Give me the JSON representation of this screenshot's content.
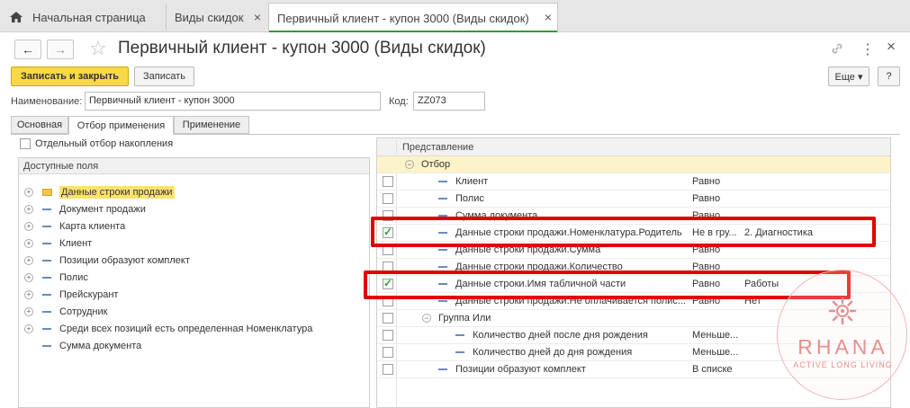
{
  "tabs": {
    "home_label": "Начальная страница",
    "tab2_label": "Виды скидок",
    "tab3_label": "Первичный клиент - купон 3000 (Виды скидок)",
    "close_glyph": "×"
  },
  "header": {
    "title": "Первичный клиент - купон 3000 (Виды скидок)",
    "back_glyph": "←",
    "forward_glyph": "→",
    "star_glyph": "☆",
    "link_glyph": "🔗",
    "menu_glyph": "⋮",
    "close_glyph": "×"
  },
  "toolbar": {
    "save_close_label": "Записать и закрыть",
    "save_label": "Записать",
    "more_label": "Еще ▾",
    "help_label": "?"
  },
  "fields": {
    "name_label": "Наименование:",
    "name_value": "Первичный клиент - купон 3000",
    "code_label": "Код:",
    "code_value": "ZZ073"
  },
  "form_tabs": [
    "Основная",
    "Отбор применения",
    "Применение"
  ],
  "separate_filter_label": "Отдельный отбор накопления",
  "left_panel": {
    "header": "Доступные поля",
    "items": [
      {
        "label": "Данные строки продажи",
        "kind": "folder",
        "selected": true
      },
      {
        "label": "Документ продажи",
        "kind": "field"
      },
      {
        "label": "Карта клиента",
        "kind": "field"
      },
      {
        "label": "Клиент",
        "kind": "field"
      },
      {
        "label": "Позиции образуют комплект",
        "kind": "field"
      },
      {
        "label": "Полис",
        "kind": "field"
      },
      {
        "label": "Прейскурант",
        "kind": "field"
      },
      {
        "label": "Сотрудник",
        "kind": "field"
      },
      {
        "label": "Среди всех позиций есть определенная Номенклатура",
        "kind": "field"
      },
      {
        "label": "Сумма документа",
        "kind": "field",
        "noexp": true
      }
    ]
  },
  "grid": {
    "header": "Представление",
    "rows": [
      {
        "type": "group",
        "name": "Отбор",
        "cond": "",
        "val": ""
      },
      {
        "checked": false,
        "name": "Клиент",
        "cond": "Равно",
        "val": ""
      },
      {
        "checked": false,
        "name": "Полис",
        "cond": "Равно",
        "val": ""
      },
      {
        "checked": false,
        "name": "Сумма документа",
        "cond": "Равно",
        "val": ""
      },
      {
        "checked": true,
        "name": "Данные строки продажи.Номенклатура.Родитель",
        "cond": "Не в гру...",
        "val": "2. Диагностика"
      },
      {
        "checked": false,
        "name": "Данные строки продажи.Сумма",
        "cond": "Равно",
        "val": ""
      },
      {
        "checked": false,
        "name": "Данные строки продажи.Количество",
        "cond": "Равно",
        "val": ""
      },
      {
        "checked": true,
        "name": "Данные строки.Имя табличной части",
        "cond": "Равно",
        "val": "Работы"
      },
      {
        "checked": false,
        "name": "Данные строки продажи.Не оплачивается полис...",
        "cond": "Равно",
        "val": "Нет"
      },
      {
        "checked": false,
        "type": "subgroup",
        "name": "Группа Или",
        "cond": "",
        "val": ""
      },
      {
        "checked": false,
        "name": "Количество дней после дня рождения",
        "cond": "Меньше...",
        "val": "",
        "indent": true
      },
      {
        "checked": false,
        "name": "Количество дней до дня рождения",
        "cond": "Меньше...",
        "val": "",
        "indent": true
      },
      {
        "checked": false,
        "name": "Позиции образуют комплект",
        "cond": "В списке",
        "val": ""
      }
    ]
  },
  "watermark": {
    "brand": "RHANA",
    "tagline": "ACTIVE LONG LIVING"
  }
}
